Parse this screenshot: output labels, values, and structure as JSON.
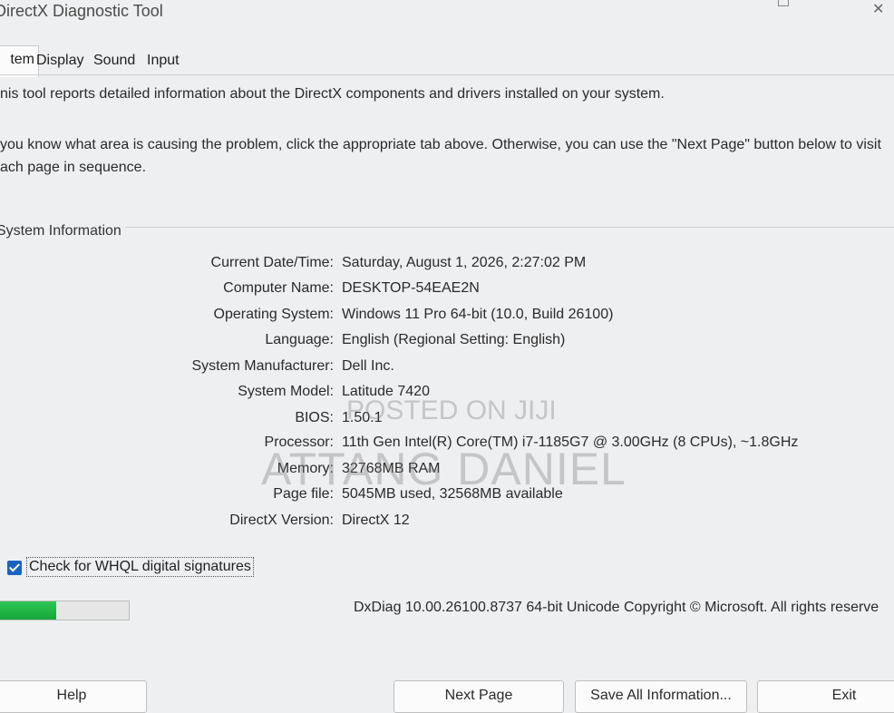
{
  "window": {
    "title": "DirectX Diagnostic Tool"
  },
  "tabs": [
    {
      "label": "tem"
    },
    {
      "label": "Display"
    },
    {
      "label": "Sound"
    },
    {
      "label": "Input"
    }
  ],
  "intro": {
    "line1": "nis tool reports detailed information about the DirectX components and drivers installed on your system.",
    "line2": " you know what area is causing the problem, click the appropriate tab above.  Otherwise, you can use the \"Next Page\" button below to visit",
    "line3": "ach page in sequence."
  },
  "system_info": {
    "group_title": "System Information",
    "rows": [
      {
        "key": "Current Date/Time:",
        "value": "Saturday, August 1, 2026, 2:27:02 PM"
      },
      {
        "key": "Computer Name:",
        "value": "DESKTOP-54EAE2N"
      },
      {
        "key": "Operating System:",
        "value": "Windows 11 Pro 64-bit (10.0, Build 26100)"
      },
      {
        "key": "Language:",
        "value": "English (Regional Setting: English)"
      },
      {
        "key": "System Manufacturer:",
        "value": "Dell Inc."
      },
      {
        "key": "System Model:",
        "value": "Latitude 7420"
      },
      {
        "key": "BIOS:",
        "value": "1.50.1"
      },
      {
        "key": "Processor:",
        "value": "11th Gen Intel(R) Core(TM) i7-1185G7 @ 3.00GHz (8 CPUs), ~1.8GHz"
      },
      {
        "key": "Memory:",
        "value": "32768MB RAM"
      },
      {
        "key": "Page file:",
        "value": "5045MB used, 32568MB available"
      },
      {
        "key": "DirectX Version:",
        "value": "DirectX 12"
      }
    ]
  },
  "whql": {
    "label": "Check for WHQL digital signatures",
    "checked": true
  },
  "progress": {
    "fraction": 0.45
  },
  "footer": {
    "text": "DxDiag 10.00.26100.8737 64-bit Unicode  Copyright © Microsoft. All rights reserve"
  },
  "buttons": {
    "help": "Help",
    "next_page": "Next Page",
    "save_all": "Save All Information...",
    "exit": "Exit"
  },
  "watermark": {
    "line1": "POSTED ON JIJI",
    "line2": "ATTANG DANIEL"
  },
  "colors": {
    "accent": "#1a63c6",
    "progress": "#22b848"
  }
}
